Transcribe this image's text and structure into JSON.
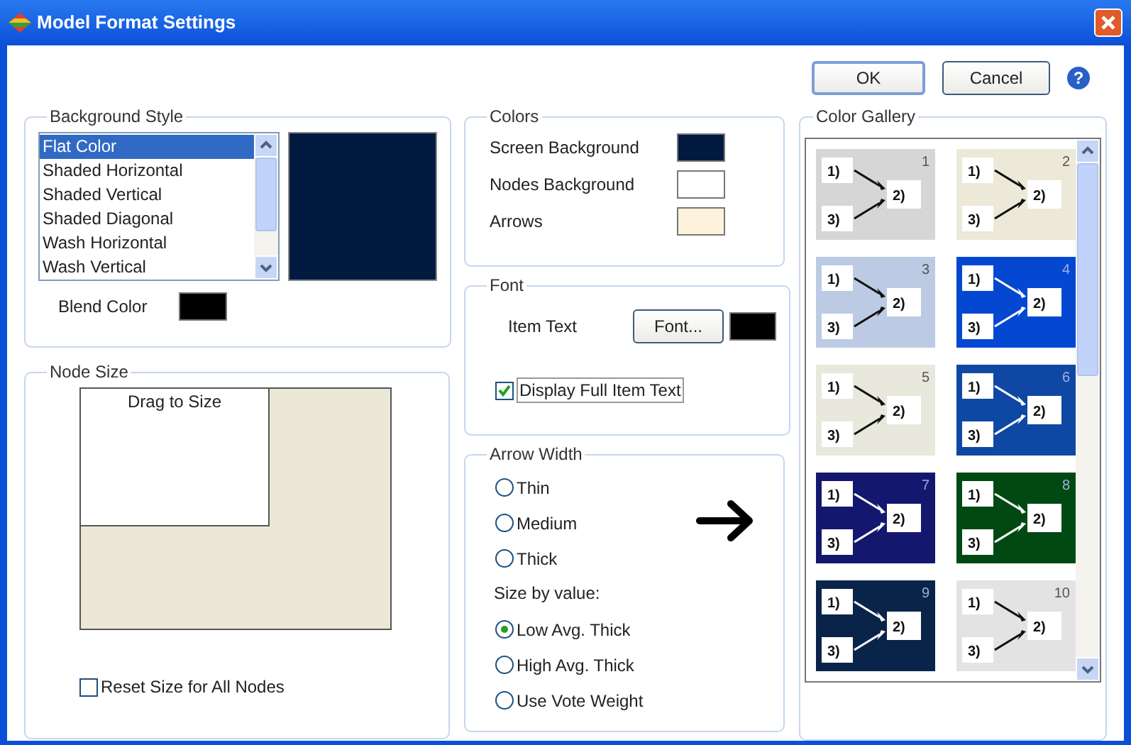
{
  "window": {
    "title": "Model Format Settings"
  },
  "buttons": [
    {
      "label": "OK"
    },
    {
      "label": "Cancel"
    }
  ],
  "help": "?",
  "background_style": {
    "title": "Background Style",
    "items": [
      {
        "label": "Flat Color",
        "selected": true
      },
      {
        "label": "Shaded Horizontal",
        "selected": false
      },
      {
        "label": "Shaded Vertical",
        "selected": false
      },
      {
        "label": "Shaded Diagonal",
        "selected": false
      },
      {
        "label": "Wash Horizontal",
        "selected": false
      },
      {
        "label": "Wash Vertical",
        "selected": false
      }
    ],
    "preview": {
      "color": "#031a40"
    },
    "blend": {
      "label": "Blend Color",
      "color": "#000000"
    }
  },
  "node_size": {
    "title": "Node Size",
    "hint": "Drag to Size",
    "reset": {
      "label": "Reset Size for All Nodes",
      "checked": false
    }
  },
  "colors": {
    "title": "Colors",
    "items": [
      {
        "label": "Screen Background",
        "color": "#031a40"
      },
      {
        "label": "Nodes Background",
        "color": "#ffffff"
      },
      {
        "label": "Arrows",
        "color": "#fdf3dc"
      }
    ]
  },
  "font": {
    "title": "Font",
    "label": "Item Text",
    "button": "Font...",
    "color": "#000000",
    "full_text": {
      "label": "Display Full Item Text",
      "checked": true
    }
  },
  "arrow_width": {
    "title": "Arrow Width",
    "options": [
      {
        "label": "Thin",
        "selected": false
      },
      {
        "label": "Medium",
        "selected": false
      },
      {
        "label": "Thick",
        "selected": false
      }
    ],
    "subtitle": "Size by value:",
    "value_options": [
      {
        "label": "Low Avg. Thick",
        "selected": true
      },
      {
        "label": "High Avg. Thick",
        "selected": false
      },
      {
        "label": "Use Vote Weight",
        "selected": false
      }
    ]
  },
  "gallery": {
    "title": "Color Gallery",
    "tiles": [
      {
        "number": "1",
        "color": "#d6d6d6",
        "nodes": [
          "1)",
          "2)",
          "3)"
        ]
      },
      {
        "number": "2",
        "color": "#ece9d8",
        "nodes": [
          "1)",
          "2)",
          "3)"
        ]
      },
      {
        "number": "3",
        "color": "#bccbe3",
        "nodes": [
          "1)",
          "2)",
          "3)"
        ]
      },
      {
        "number": "4",
        "color": "#0448d2",
        "nodes": [
          "1)",
          "2)",
          "3)"
        ]
      },
      {
        "number": "5",
        "color": "#e9e8dd",
        "nodes": [
          "1)",
          "2)",
          "3)"
        ]
      },
      {
        "number": "6",
        "color": "#0f48a4",
        "nodes": [
          "1)",
          "2)",
          "3)"
        ]
      },
      {
        "number": "7",
        "color": "#13186e",
        "nodes": [
          "1)",
          "2)",
          "3)"
        ]
      },
      {
        "number": "8",
        "color": "#004913",
        "nodes": [
          "1)",
          "2)",
          "3)"
        ]
      },
      {
        "number": "9",
        "color": "#0a2449",
        "nodes": [
          "1)",
          "2)",
          "3)"
        ]
      },
      {
        "number": "10",
        "color": "#e3e3e3",
        "nodes": [
          "1)",
          "2)",
          "3)"
        ]
      }
    ]
  }
}
